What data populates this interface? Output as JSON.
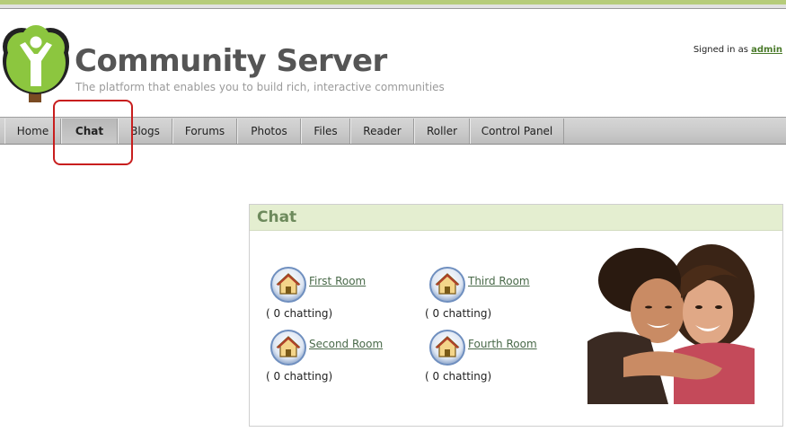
{
  "header": {
    "site_title": "Community Server",
    "tagline": "The platform that enables you to build rich, interactive communities",
    "signed_in_prefix": "Signed in as",
    "signed_in_user": "admin",
    "logo_icon": "tree-person-logo"
  },
  "nav": {
    "items": [
      {
        "label": "Home"
      },
      {
        "label": "Chat"
      },
      {
        "label": "Blogs"
      },
      {
        "label": "Forums"
      },
      {
        "label": "Photos"
      },
      {
        "label": "Files"
      },
      {
        "label": "Reader"
      },
      {
        "label": "Roller"
      },
      {
        "label": "Control Panel"
      }
    ],
    "active": "Chat"
  },
  "chat_panel": {
    "title": "Chat",
    "rooms": [
      {
        "name": "First Room",
        "count": "( 0 chatting)",
        "icon": "home-icon"
      },
      {
        "name": "Third Room",
        "count": "( 0 chatting)",
        "icon": "home-icon"
      },
      {
        "name": "Second Room",
        "count": "( 0 chatting)",
        "icon": "home-icon"
      },
      {
        "name": "Fourth Room",
        "count": "( 0 chatting)",
        "icon": "home-icon"
      }
    ],
    "photo": "couple-photo"
  },
  "colors": {
    "accent_green": "#b6cc7a",
    "panel_header": "#e4eed0",
    "panel_title": "#6d8a5c",
    "highlight": "#c81e1e",
    "link": "#4a6a4a",
    "signed_in_link": "#4a7a2a"
  }
}
